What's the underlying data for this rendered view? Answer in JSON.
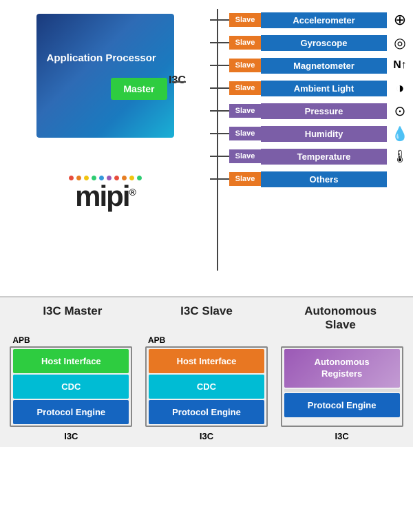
{
  "top": {
    "app_processor_label": "Application Processor",
    "master_label": "Master",
    "i3c_label": "I3C",
    "mipi_text": "mipi",
    "mipi_reg": "®",
    "slaves": [
      {
        "name": "Accelerometer",
        "color_class": "slave-accelerometer",
        "badge_color": "#e87722",
        "icon": "⊕"
      },
      {
        "name": "Gyroscope",
        "color_class": "slave-gyroscope",
        "badge_color": "#e87722",
        "icon": "◎"
      },
      {
        "name": "Magnetometer",
        "color_class": "slave-magnetometer",
        "badge_color": "#e87722",
        "icon": "🧭"
      },
      {
        "name": "Ambient Light",
        "color_class": "slave-ambient",
        "badge_color": "#e87722",
        "icon": "◑"
      },
      {
        "name": "Pressure",
        "color_class": "slave-pressure",
        "badge_color": "#7b5ea7",
        "icon": "⊙"
      },
      {
        "name": "Humidity",
        "color_class": "slave-humidity",
        "badge_color": "#7b5ea7",
        "icon": "💧"
      },
      {
        "name": "Temperature",
        "color_class": "slave-temperature",
        "badge_color": "#7b5ea7",
        "icon": "🌡"
      },
      {
        "name": "Others",
        "color_class": "slave-others",
        "badge_color": "#e87722",
        "icon": ""
      }
    ]
  },
  "bottom": {
    "blocks": [
      {
        "title": "I3C Master",
        "apb": "APB",
        "rows": [
          {
            "label": "Host Interface",
            "color": "green"
          },
          {
            "label": "CDC",
            "color": "cyan"
          },
          {
            "label": "Protocol Engine",
            "color": "blue"
          }
        ],
        "i3c_label": "I3C"
      },
      {
        "title": "I3C Slave",
        "apb": "APB",
        "rows": [
          {
            "label": "Host Interface",
            "color": "orange"
          },
          {
            "label": "CDC",
            "color": "cyan"
          },
          {
            "label": "Protocol Engine",
            "color": "blue"
          }
        ],
        "i3c_label": "I3C"
      },
      {
        "title": "Autonomous\nSlave",
        "apb": "",
        "rows": [
          {
            "label": "Autonomous\nRegisters",
            "color": "purple"
          },
          {
            "label": "Protocol Engine",
            "color": "blue"
          }
        ],
        "i3c_label": "I3C"
      }
    ]
  },
  "icons": {
    "accelerometer": "⊕",
    "gyroscope": "◎",
    "magnetometer": "N",
    "ambient_light": "◑",
    "pressure": "⊙",
    "humidity": "%",
    "temperature": "|||",
    "slave_badge": "Slave"
  }
}
